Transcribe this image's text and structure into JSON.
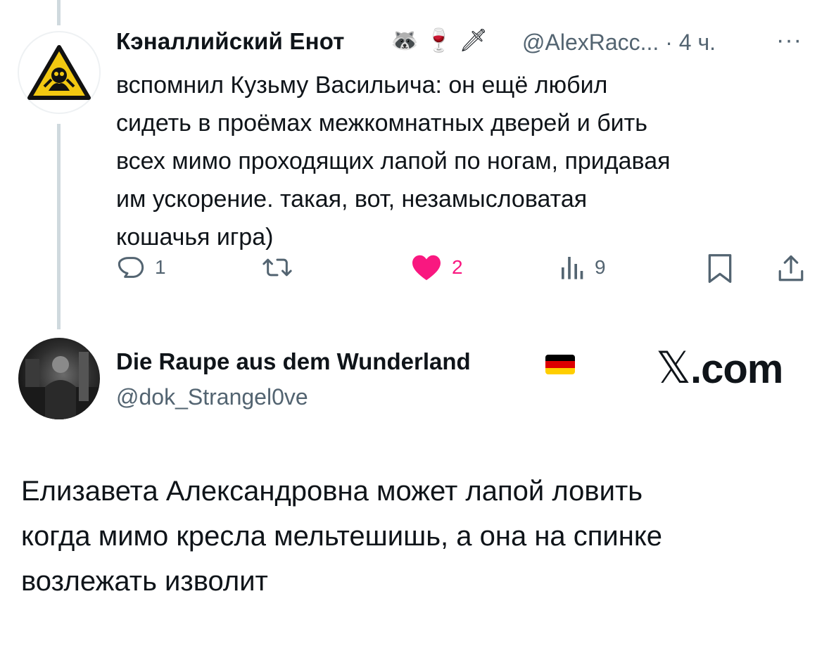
{
  "tweet1": {
    "display_name": "Кэналлийский Енот",
    "emojis": "🦝 🍷 🗡",
    "handle": "@AlexRacc...",
    "separator": "·",
    "time": "4 ч.",
    "more": "···",
    "text_lines": [
      "вспомнил Кузьму Васильича:  он ещё любил",
      "сидеть в проёмах межкомнатных дверей и бить",
      "всех мимо проходящих лапой по ногам, придавая",
      "им ускорение. такая, вот, незамысловатая",
      "кошачья игра)"
    ],
    "actions": {
      "replies": "1",
      "retweets": "",
      "likes": "2",
      "views": "9"
    },
    "icons": {
      "reply": "reply-icon",
      "retweet": "retweet-icon",
      "like": "heart-filled-icon",
      "views": "views-icon",
      "bookmark": "bookmark-icon",
      "share": "share-icon"
    }
  },
  "tweet2": {
    "display_name": "Die Raupe aus dem Wunderland",
    "flag": "german-flag-icon",
    "handle": "@dok_Strangel0ve",
    "brand_mark": "𝕏",
    "brand_suffix": ".com",
    "text_lines": [
      "Елизавета Александровна может лапой ловить",
      "когда мимо кресла мельтешишь, а она на спинке",
      "возлежать изволит"
    ]
  },
  "colors": {
    "text": "#0f1419",
    "secondary": "#536471",
    "like": "#f91880",
    "thread": "#cfd9de",
    "warning_yellow": "#f2c811"
  }
}
